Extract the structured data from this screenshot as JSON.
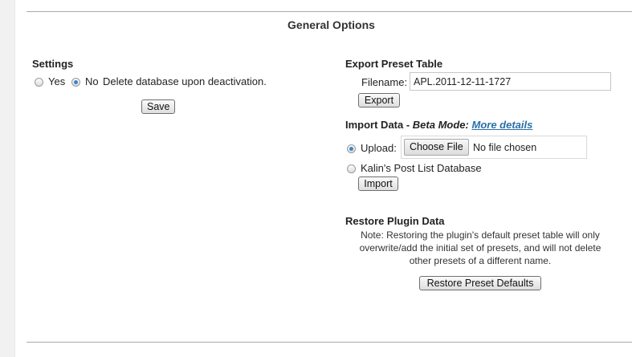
{
  "page_title": "General Options",
  "settings": {
    "title": "Settings",
    "yes_label": "Yes",
    "no_label": "No",
    "description": "Delete database upon deactivation.",
    "selected": "No",
    "save_button": "Save"
  },
  "export": {
    "title": "Export Preset Table",
    "filename_label": "Filename:",
    "filename_value": "APL.2011-12-11-1727",
    "export_button": "Export"
  },
  "import": {
    "title_prefix": "Import Data - ",
    "title_beta": "Beta Mode:",
    "more_details_link": "More details",
    "upload_label": "Upload:",
    "choose_file_button": "Choose File",
    "no_file_text": "No file chosen",
    "kalin_label": "Kalin's Post List Database",
    "selected": "Upload",
    "import_button": "Import"
  },
  "restore": {
    "title": "Restore Plugin Data",
    "note_line1": "Note: Restoring the plugin's default preset table will only",
    "note_line2": "overwrite/add the initial set of presets, and will not delete",
    "note_line3": "other presets of a different name.",
    "restore_button": "Restore Preset Defaults"
  },
  "colors": {
    "link": "#2870a8",
    "radio_checked": "#3c84c8"
  }
}
